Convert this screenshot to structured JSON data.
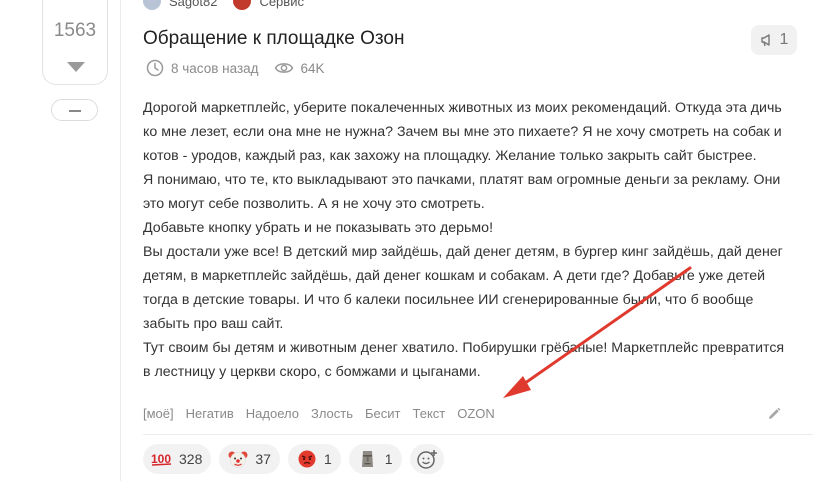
{
  "vote": {
    "count": "1563"
  },
  "author": {
    "name": "Sagot82",
    "community": "Сервис"
  },
  "post": {
    "title": "Обращение к площадке Озон",
    "time": "8 часов назад",
    "views": "64K",
    "share_count": "1",
    "body_lines": [
      "Дорогой маркетплейс, уберите покалеченных животных из моих рекомендаций. Откуда эта дичь",
      "ко мне лезет, если она мне не нужна? Зачем вы мне это пихаете? Я не хочу смотреть на собак и",
      "котов - уродов, каждый раз, как захожу на площадку. Желание только закрыть сайт быстрее.",
      "Я понимаю, что те, кто выкладывают это пачками, платят вам огромные деньги за рекламу. Они",
      "это могут себе позволить. А я не хочу это смотреть.",
      "Добавьте кнопку убрать и не показывать это дерьмо!",
      "Вы достали уже все! В детский мир зайдёшь, дай денег детям, в бургер кинг зайдёшь, дай денег",
      "детям, в маркетплейс зайдёшь, дай денег кошкам и собакам. А дети где? Добавьте уже детей",
      "тогда в детские товары. И что б калеки посильнее ИИ сгенерированные были, что б вообще",
      "забыть про ваш сайт.",
      "Тут своим бы детям и животным денег хватило. Побирушки грёбаные! Маркетплейс превратится",
      "в лестницу у церкви скоро, с бомжами и цыганами."
    ],
    "tags": [
      "[моё]",
      "Негатив",
      "Надоело",
      "Злость",
      "Бесит",
      "Текст",
      "OZON"
    ]
  },
  "reactions": [
    {
      "icon": "hundred-points-icon",
      "count": "328"
    },
    {
      "icon": "clown-face-icon",
      "count": "37"
    },
    {
      "icon": "angry-face-icon",
      "count": "1"
    },
    {
      "icon": "moai-icon",
      "count": "1"
    }
  ],
  "colors": {
    "annotation_arrow": "#e03a2f",
    "text": "#333333",
    "muted": "#8a8a8a"
  }
}
